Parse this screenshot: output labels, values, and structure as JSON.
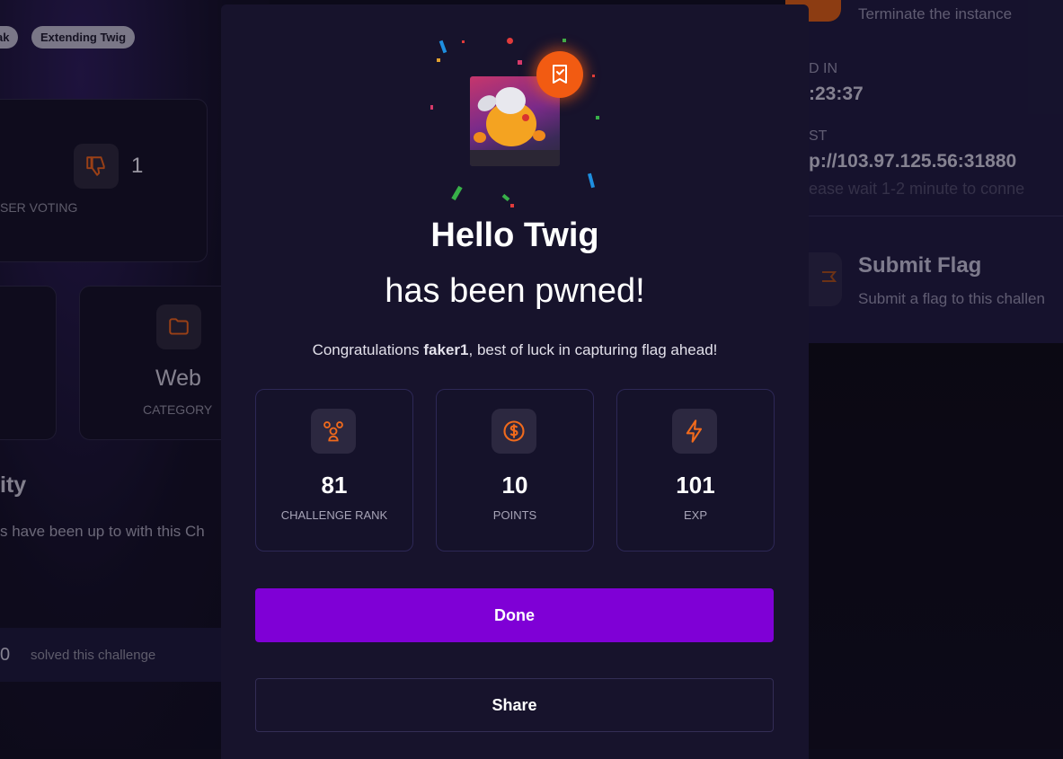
{
  "background": {
    "tags": [
      "ak",
      "Extending Twig"
    ],
    "voting": {
      "count": "1",
      "label": "SER VOTING"
    },
    "category": {
      "value": "Web",
      "label": "CATEGORY"
    },
    "activity": {
      "heading": "ity",
      "text": "s have been up to with this Ch"
    },
    "solved": {
      "count": "0",
      "text": "solved this challenge"
    },
    "instance": {
      "terminate_text": "Terminate the instance",
      "ends_label": "D IN",
      "ends_value": ":23:37",
      "host_label": "ST",
      "host_value": "p://103.97.125.56:31880",
      "host_note": "ease wait 1-2 minute to conne"
    },
    "submit": {
      "title": "Submit Flag",
      "subtitle": "Submit a flag to this challen"
    }
  },
  "modal": {
    "title_line1": "Hello Twig",
    "title_line2": "has been pwned!",
    "congrats_prefix": "Congratulations ",
    "username": "faker1",
    "congrats_suffix": ", best of luck in capturing flag ahead!",
    "stats": [
      {
        "icon": "users-rank-icon",
        "value": "81",
        "label": "CHALLENGE RANK"
      },
      {
        "icon": "coin-dollar-icon",
        "value": "10",
        "label": "POINTS"
      },
      {
        "icon": "lightning-bolt-icon",
        "value": "101",
        "label": "EXP"
      }
    ],
    "done_label": "Done",
    "share_label": "Share"
  },
  "colors": {
    "accent_orange": "#f06a1c",
    "primary_purple": "#7f00d6",
    "modal_bg": "#17132c"
  }
}
